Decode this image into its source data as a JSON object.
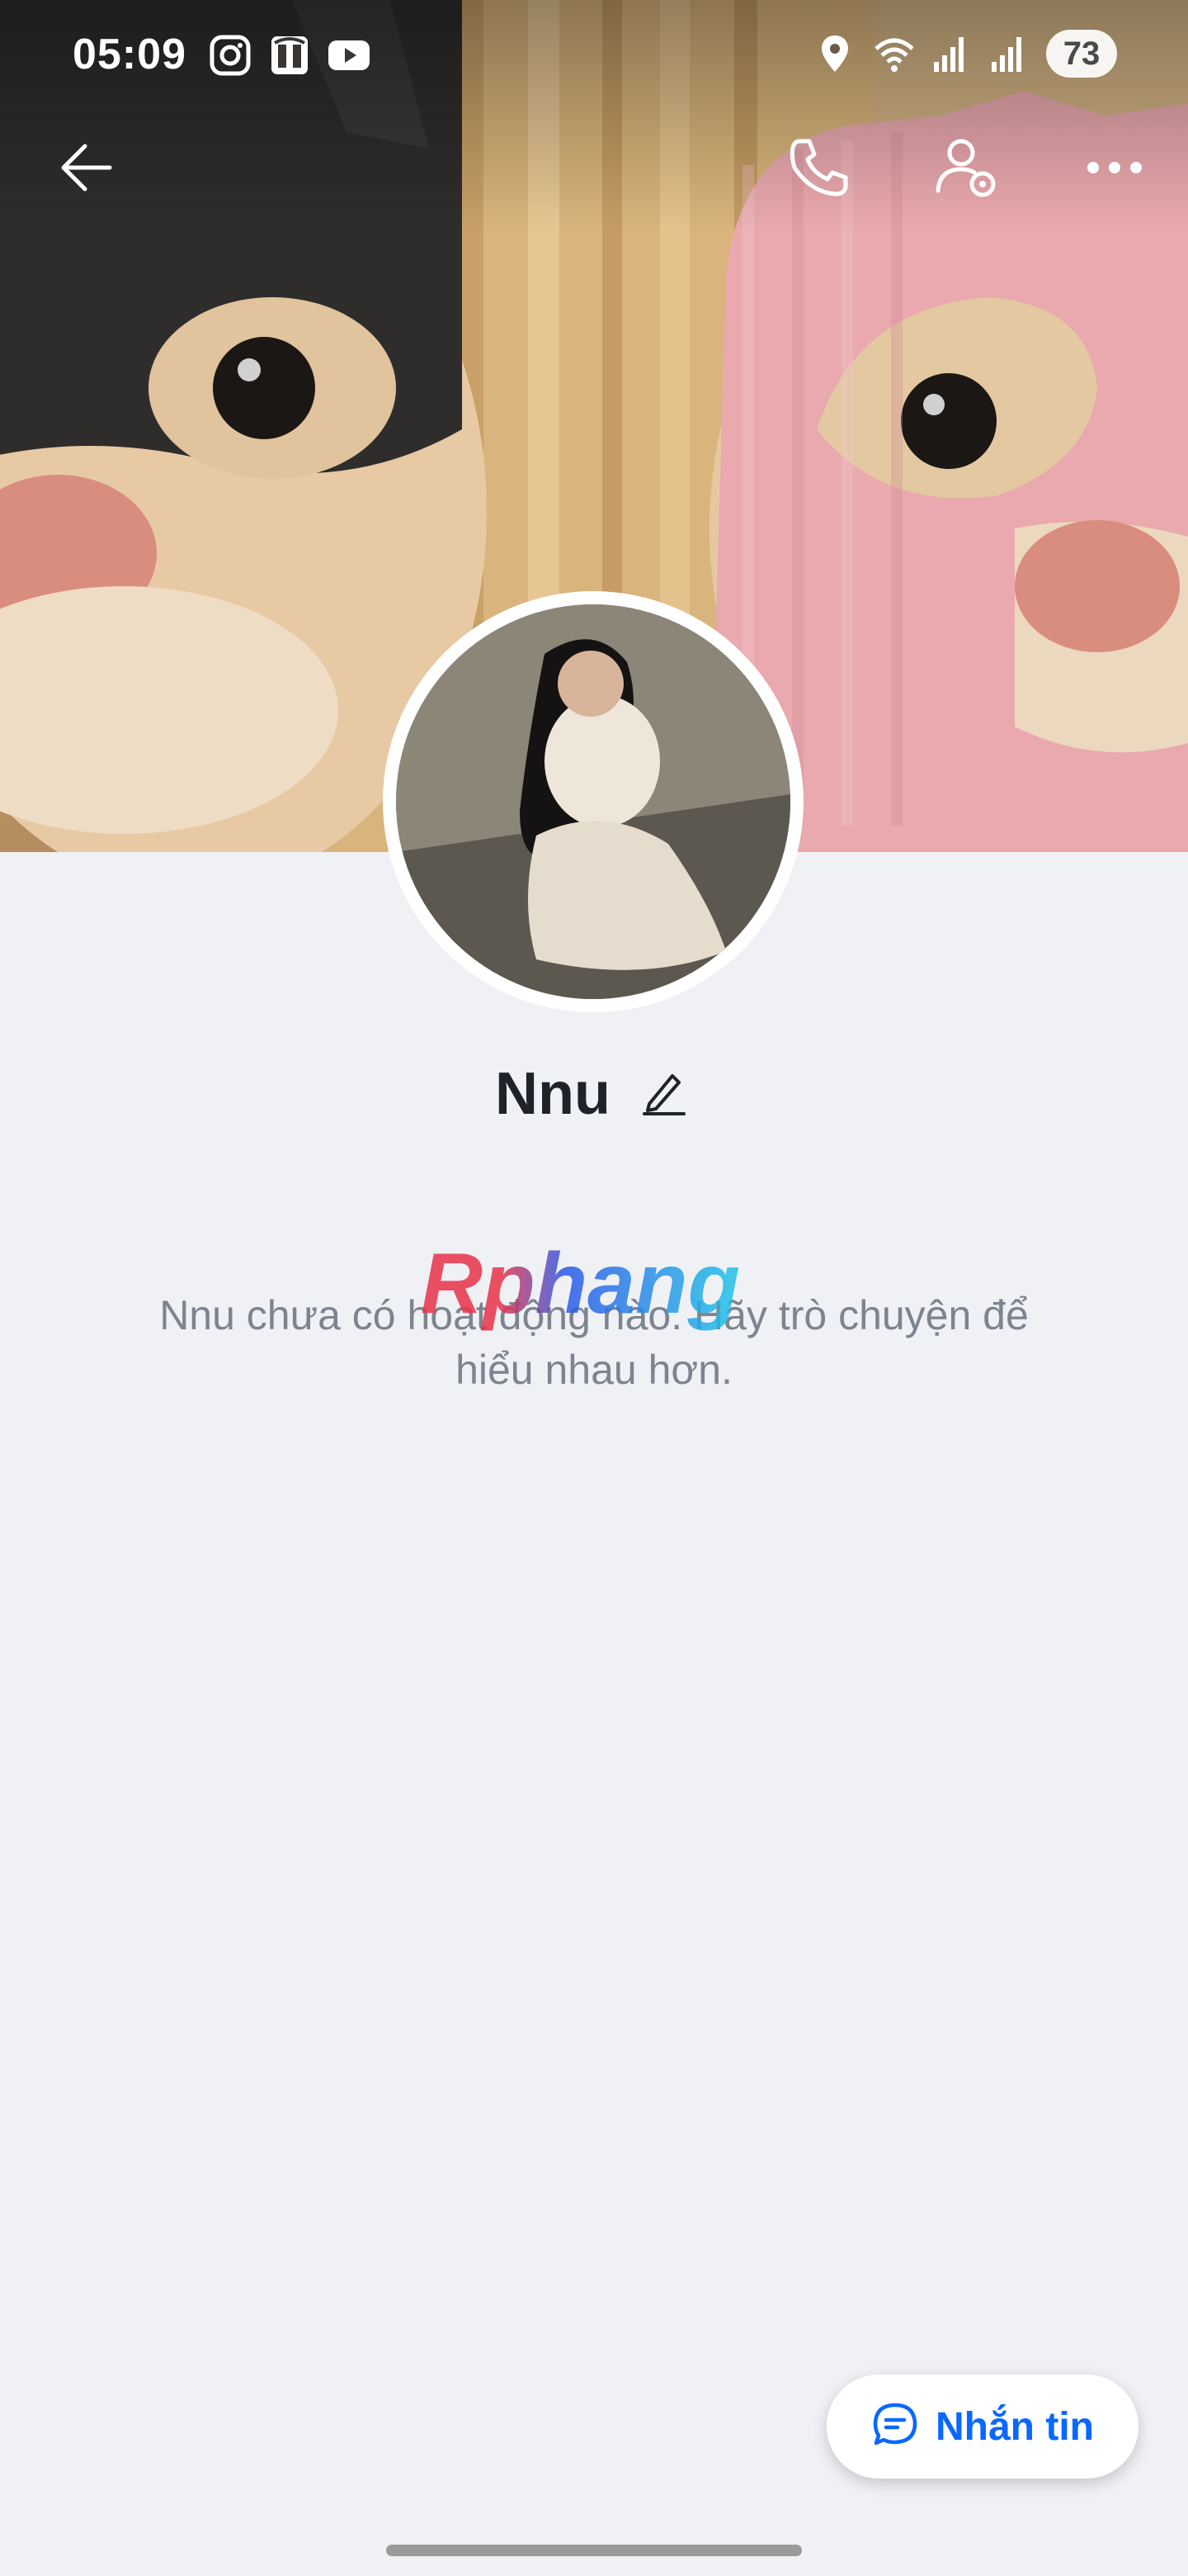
{
  "status_bar": {
    "time": "05:09",
    "app_icons": [
      "instagram-icon",
      "store-icon",
      "youtube-icon"
    ],
    "system_icons": [
      "location-icon",
      "wifi-icon",
      "signal-icon",
      "signal-icon"
    ],
    "battery_level": "73"
  },
  "toolbar": {
    "icons": [
      "back-arrow-icon",
      "phone-icon",
      "user-settings-icon",
      "more-icon"
    ]
  },
  "profile": {
    "name": "Nnu"
  },
  "empty_state": {
    "message": "Nnu chưa có hoạt động nào. Hãy trò chuyện để hiểu nhau hơn."
  },
  "watermark": {
    "text": "Rphang"
  },
  "actions": {
    "message_label": "Nhắn tin"
  },
  "colors": {
    "accent": "#0a68fe",
    "background": "#eff1f5",
    "muted_text": "#7d8490"
  }
}
